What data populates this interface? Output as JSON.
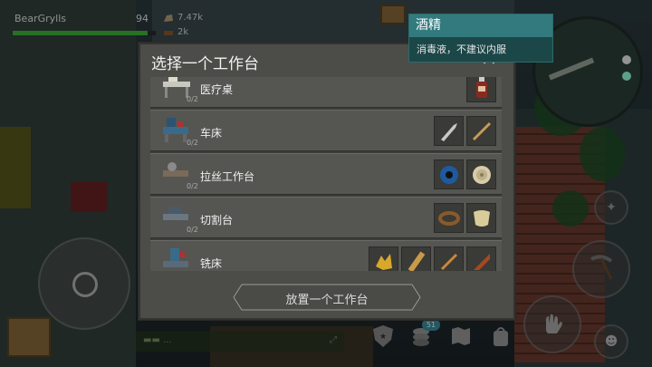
{
  "player": {
    "name": "BearGrylls",
    "health": "94",
    "health_fraction": 0.94
  },
  "resources": [
    {
      "icon": "stone-icon",
      "value": "7.47k"
    },
    {
      "icon": "log-icon",
      "value": "2k"
    }
  ],
  "dialog": {
    "title": "选择一个工作台",
    "close_icon": "close-icon",
    "place_button": "放置一个工作台",
    "rows": [
      {
        "icon": "medical-table-icon",
        "label": "医疗桌",
        "count": "0/2",
        "materials": [
          "bottle-icon"
        ]
      },
      {
        "icon": "lathe-icon",
        "label": "车床",
        "count": "0/2",
        "materials": [
          "knife-icon",
          "stick-icon"
        ]
      },
      {
        "icon": "wire-drawing-bench-icon",
        "label": "拉丝工作台",
        "count": "0/2",
        "materials": [
          "wire-spool-icon",
          "rope-coil-icon"
        ]
      },
      {
        "icon": "cutting-table-icon",
        "label": "切割台",
        "count": "0/2",
        "materials": [
          "leather-belt-icon",
          "cloth-icon"
        ]
      },
      {
        "icon": "milling-machine-icon",
        "label": "铣床",
        "count": "",
        "materials": [
          "gold-parts-icon",
          "plank-icon",
          "rod-icon",
          "hammer-part-icon"
        ]
      }
    ]
  },
  "tooltip": {
    "title": "酒精",
    "description": "消毒液，不建议内服"
  },
  "hud": {
    "inventory_badge": "51"
  },
  "colors": {
    "health": "#3fb63c",
    "tooltip_header": "#327a7d",
    "dialog_bg": "#4c4c48"
  }
}
